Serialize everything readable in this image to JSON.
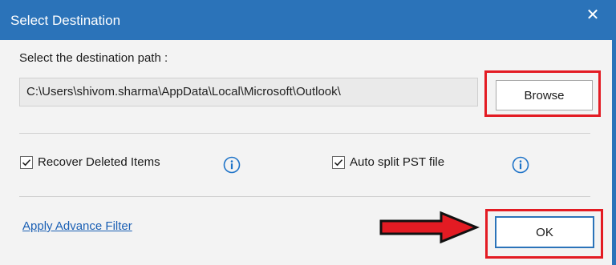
{
  "window": {
    "title": "Select Destination",
    "close_glyph": "✕"
  },
  "destination": {
    "label": "Select the destination path :",
    "path_value": "C:\\Users\\shivom.sharma\\AppData\\Local\\Microsoft\\Outlook\\",
    "browse_label": "Browse"
  },
  "options": {
    "recover_deleted": {
      "label": "Recover Deleted Items",
      "checked": true
    },
    "auto_split": {
      "label": "Auto split PST file",
      "checked": true
    }
  },
  "footer": {
    "advance_filter_label": "Apply Advance Filter",
    "ok_label": "OK"
  },
  "colors": {
    "titlebar": "#2b73b9",
    "highlight": "#e31b23",
    "info_icon": "#1e73c8",
    "link": "#1a5fb4"
  },
  "icons": {
    "close": "close-icon",
    "info": "info-icon",
    "check": "checkmark-icon",
    "arrow": "red-arrow-annotation"
  }
}
